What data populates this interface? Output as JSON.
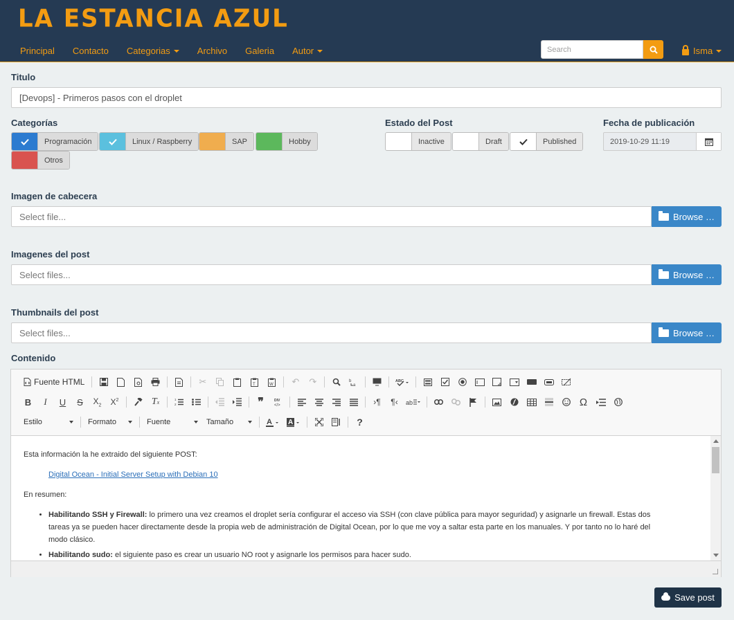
{
  "header": {
    "brand": "LA ESTANCIA AZUL",
    "nav": [
      "Principal",
      "Contacto",
      "Categorias",
      "Archivo",
      "Galeria",
      "Autor"
    ],
    "search_placeholder": "Search",
    "user": "Isma"
  },
  "form": {
    "titulo_label": "Titulo",
    "titulo_value": "[Devops] - Primeros pasos con el droplet",
    "categorias_label": "Categorías",
    "categorias": [
      {
        "label": "Programación",
        "checked": true,
        "color": "#2c7bd0"
      },
      {
        "label": "Linux / Raspberry",
        "checked": true,
        "color": "#5bc0de"
      },
      {
        "label": "SAP",
        "checked": false,
        "color": "#f0ad4e"
      },
      {
        "label": "Hobby",
        "checked": false,
        "color": "#5cb85c"
      },
      {
        "label": "Otros",
        "checked": false,
        "color": "#d9534f"
      }
    ],
    "estado_label": "Estado del Post",
    "estados": [
      {
        "label": "Inactive",
        "checked": false
      },
      {
        "label": "Draft",
        "checked": false
      },
      {
        "label": "Published",
        "checked": true
      }
    ],
    "fecha_label": "Fecha de publicación",
    "fecha_value": "2019-10-29 11:19",
    "imagen_cabecera_label": "Imagen de cabecera",
    "imagen_cabecera_placeholder": "Select file...",
    "imagenes_post_label": "Imagenes del post",
    "imagenes_post_placeholder": "Select files...",
    "thumbnails_label": "Thumbnails del post",
    "thumbnails_placeholder": "Select files...",
    "browse_label": "Browse …",
    "contenido_label": "Contenido",
    "save_label": "Save post"
  },
  "editor": {
    "source_label": "Fuente HTML",
    "combos": [
      "Estilo",
      "Formato",
      "Fuente",
      "Tamaño"
    ],
    "content": {
      "intro": "Esta información la he extraido del siguiente POST:",
      "link": "Digital Ocean - Initial Server Setup with Debian 10",
      "resumen": "En resumen:",
      "item1_bold": "Habilitando SSH y Firewall:",
      "item1_text": " lo primero una vez creamos el droplet sería configurar el acceso via SSH (con clave pública para mayor seguridad) y asignarle un firewall. Estas dos tareas ya se pueden hacer directamente desde la propia web de administración de Digital Ocean, por lo que me voy a saltar esta parte en los manuales. Y por tanto no lo haré del modo clásico.",
      "item2_bold": "Habilitando sudo:",
      "item2_text": " el siguiente paso es crear un usuario NO root y asignarle los permisos para hacer sudo."
    }
  },
  "colors": {
    "header_bg": "#253a53",
    "accent": "#f39c12",
    "browse_bg": "#3a87c8",
    "save_bg": "#1f3347"
  }
}
